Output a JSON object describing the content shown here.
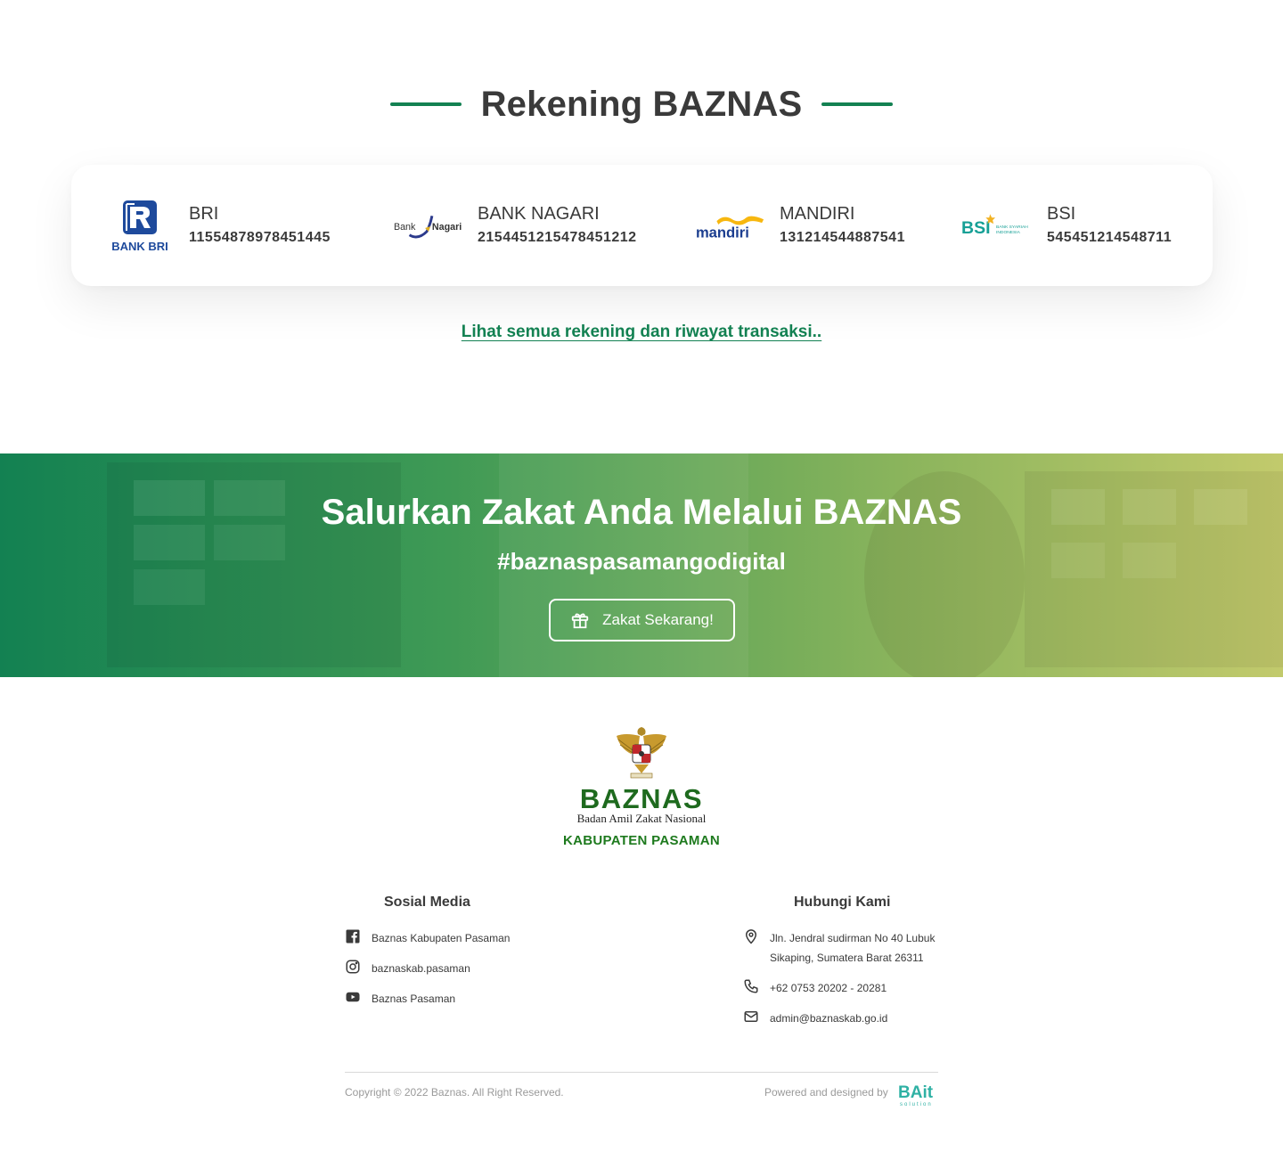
{
  "rekening": {
    "title": "Rekening BAZNAS",
    "banks": [
      {
        "name": "BRI",
        "account": "11554878978451445",
        "logo_text": "BANK BRI",
        "logo": "bri-logo"
      },
      {
        "name": "BANK NAGARI",
        "account": "2154451215478451212",
        "logo_text": "Bank Nagari",
        "logo": "bank-nagari-logo"
      },
      {
        "name": "MANDIRI",
        "account": "131214544887541",
        "logo_text": "mandiri",
        "logo": "mandiri-logo"
      },
      {
        "name": "BSI",
        "account": "545451214548711",
        "logo_text": "BSI",
        "logo_sub": "BANK SYARIAH INDONESIA",
        "logo": "bsi-logo"
      }
    ],
    "see_all_link": "Lihat semua rekening dan riwayat transaksi.."
  },
  "banner": {
    "title": "Salurkan Zakat Anda Melalui BAZNAS",
    "hashtag": "#baznaspasamangodigital",
    "cta_label": "Zakat Sekarang!",
    "cta_icon": "gift-icon"
  },
  "footer": {
    "logo": {
      "word": "BAZNAS",
      "subtitle": "Badan Amil Zakat Nasional",
      "region": "KABUPATEN PASAMAN"
    },
    "social": {
      "title": "Sosial Media",
      "items": [
        {
          "icon": "facebook-icon",
          "label": "Baznas Kabupaten Pasaman"
        },
        {
          "icon": "instagram-icon",
          "label": "baznaskab.pasaman"
        },
        {
          "icon": "youtube-icon",
          "label": "Baznas Pasaman"
        }
      ]
    },
    "contact": {
      "title": "Hubungi Kami",
      "address_line1": "Jln. Jendral sudirman No 40 Lubuk",
      "address_line2": "Sikaping, Sumatera Barat 26311",
      "phone": "+62 0753 20202 - 20281",
      "email": "admin@baznaskab.go.id"
    },
    "copyright": "Copyright © 2022 Baznas. All Right Reserved.",
    "powered": "Powered and designed by",
    "brand_text": "BAit",
    "brand_sub": "solution"
  },
  "colors": {
    "primary": "#138152",
    "banner_start": "#138152",
    "banner_end": "#c2ca6c",
    "text": "#3a3a3a"
  }
}
